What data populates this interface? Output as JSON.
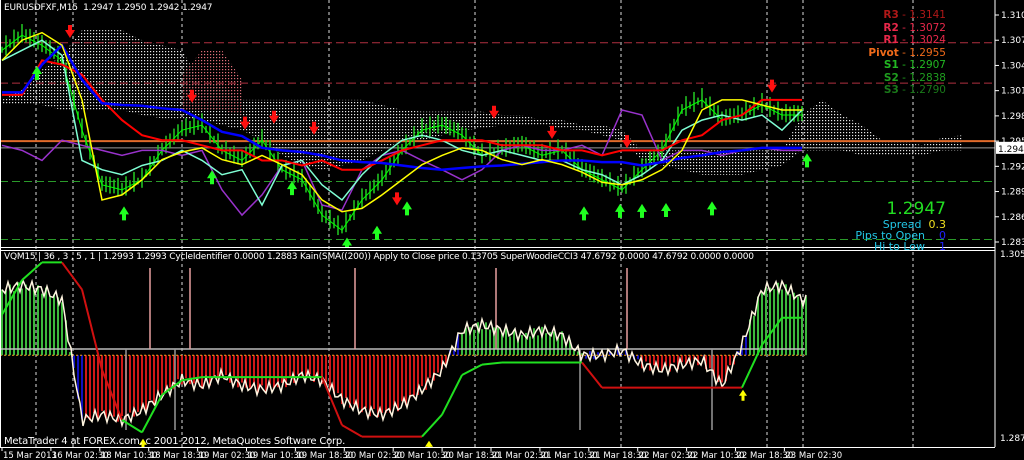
{
  "header": {
    "symbol": "EURUSDFXF,M15",
    "ohlc": "1.2947 1.2950 1.2942 1.2947"
  },
  "indicator_header": "VQM15 | 36 , 3 , 5 , 1 | 1.2993 1.2993 CycleIdentifier 0.0000 1.2883 Kain(SMA((200)) Apply to Close price 0.13705 SuperWoodieCCI3 47.6792 0.0000 47.6792 0.0000 0.0000",
  "copyright": "MetaTrader 4 at FOREX.com, c 2001-2012, MetaQuotes Software Corp.",
  "pivots": [
    {
      "label": "R3",
      "value": "1.3141",
      "color": "#b01818"
    },
    {
      "label": "R2",
      "value": "1.3072",
      "color": "#e8284a"
    },
    {
      "label": "R1",
      "value": "1.3024",
      "color": "#e8284a"
    },
    {
      "label": "Pivot",
      "value": "1.2955",
      "color": "#f06a1a"
    },
    {
      "label": "S1",
      "value": "1.2907",
      "color": "#22b822"
    },
    {
      "label": "S2",
      "value": "1.2838",
      "color": "#1f9e1f"
    },
    {
      "label": "S3",
      "value": "1.2790",
      "color": "#1a7a1a"
    }
  ],
  "info": {
    "price": "1.2947",
    "spread_label": "Spread",
    "spread_value": "0.3",
    "pips_label": "Pips to Open",
    "pips_value": "0",
    "hilo_label": "Hi to Low",
    "hilo_value": "1"
  },
  "colors": {
    "up": "#00ff00",
    "down": "#ff0000",
    "cyan": "#7fffd4",
    "purple": "#9932cc",
    "yellow": "#ffff00",
    "blue": "#0000ff"
  },
  "chart_data": [
    {
      "type": "line",
      "title": "EURUSDFXF,M15",
      "ylim": [
        1.2822,
        1.312
      ],
      "price_ticks": [
        "1.3105",
        "1.3075",
        "1.3045",
        "1.3015",
        "1.2985",
        "1.2955",
        "1.2925",
        "1.2895",
        "1.2865",
        "1.2835"
      ],
      "current_price": "1.2947",
      "time_labels": [
        "15 Mar 2013",
        "16 Mar 02:30",
        "18 Mar 10:30",
        "18 Mar 18:30",
        "19 Mar 02:30",
        "19 Mar 10:30",
        "19 Mar 18:30",
        "20 Mar 02:30",
        "20 Mar 10:30",
        "20 Mar 18:30",
        "21 Mar 02:30",
        "21 Mar 10:30",
        "21 Mar 18:30",
        "22 Mar 02:30",
        "22 Mar 10:30",
        "22 Mar 18:30",
        "23 Mar 02:30"
      ],
      "pivot_lines": [
        1.3072,
        1.3024,
        1.2955,
        1.2907,
        1.2838
      ],
      "series": [
        {
          "name": "close",
          "color": "#00ff00",
          "values": [
            1.3063,
            1.3081,
            1.3069,
            1.3051,
            1.2968,
            1.2903,
            1.2897,
            1.2909,
            1.2944,
            1.2968,
            1.2974,
            1.2944,
            1.2932,
            1.2956,
            1.2921,
            1.2909,
            1.2867,
            1.2849,
            1.2885,
            1.2909,
            1.2944,
            1.2968,
            1.2974,
            1.2962,
            1.2938,
            1.2944,
            1.295,
            1.2938,
            1.2944,
            1.2921,
            1.2909,
            1.2897,
            1.2921,
            1.2944,
            1.2992,
            1.3004,
            1.298,
            1.2986,
            1.2998,
            1.2986,
            1.2986
          ]
        },
        {
          "name": "purple",
          "color": "#9932cc",
          "values": [
            1.295,
            1.2944,
            1.2932,
            1.2956,
            1.295,
            1.2944,
            1.2938,
            1.2944,
            1.2944,
            1.2938,
            1.2944,
            1.2897,
            1.2867,
            1.2891,
            1.2926,
            1.2932,
            1.2879,
            1.2873,
            1.2921,
            1.2938,
            1.2944,
            1.2932,
            1.2921,
            1.2909,
            1.2921,
            1.2944,
            1.295,
            1.2944,
            1.2944,
            1.295,
            1.2938,
            1.2992,
            1.2986,
            1.2932,
            1.2944,
            1.2944,
            1.2938,
            1.2944,
            1.2947,
            1.2944,
            1.2944
          ]
        },
        {
          "name": "cyan",
          "color": "#7fffd4",
          "values": [
            1.3051,
            1.3063,
            1.3075,
            1.3057,
            1.2932,
            1.2921,
            1.2915,
            1.2926,
            1.2932,
            1.2944,
            1.2932,
            1.2915,
            1.2921,
            1.2879,
            1.2926,
            1.2932,
            1.2903,
            1.2885,
            1.2915,
            1.2938,
            1.2956,
            1.2962,
            1.2956,
            1.2944,
            1.2938,
            1.2944,
            1.2938,
            1.2932,
            1.2932,
            1.2921,
            1.2915,
            1.2903,
            1.2915,
            1.2932,
            1.2968,
            1.298,
            1.2986,
            1.298,
            1.2986,
            1.2968,
            1.2992
          ]
        },
        {
          "name": "red-step",
          "color": "#ff0000",
          "values": [
            1.301,
            1.301,
            1.3051,
            1.3046,
            1.3034,
            1.3004,
            1.298,
            1.2962,
            1.2956,
            1.2956,
            1.295,
            1.2944,
            1.2944,
            1.2932,
            1.2932,
            1.2926,
            1.2932,
            1.2921,
            1.2921,
            1.2932,
            1.2944,
            1.295,
            1.2956,
            1.2956,
            1.2956,
            1.295,
            1.295,
            1.295,
            1.2944,
            1.2944,
            1.2938,
            1.2944,
            1.2944,
            1.2944,
            1.2956,
            1.2962,
            1.298,
            1.2986,
            1.3004,
            1.3004,
            1.3004
          ]
        },
        {
          "name": "blue",
          "color": "#0000ff",
          "values": [
            1.3013,
            1.3013,
            1.3046,
            1.3069,
            1.3028,
            1.3,
            1.2998,
            1.2997,
            1.2994,
            1.2992,
            1.298,
            1.2966,
            1.2961,
            1.2947,
            1.2944,
            1.2942,
            1.2938,
            1.2932,
            1.293,
            1.2929,
            1.2926,
            1.2923,
            1.2921,
            1.2923,
            1.2925,
            1.2926,
            1.2928,
            1.293,
            1.2932,
            1.2932,
            1.293,
            1.293,
            1.2926,
            1.293,
            1.2935,
            1.2938,
            1.2942,
            1.2944,
            1.2947,
            1.2947,
            1.2947
          ]
        },
        {
          "name": "yellow",
          "color": "#ffff00",
          "values": [
            1.3051,
            1.3075,
            1.3084,
            1.3069,
            1.3004,
            1.2885,
            1.2891,
            1.2909,
            1.2933,
            1.2942,
            1.2947,
            1.2933,
            1.2927,
            1.2938,
            1.2927,
            1.2915,
            1.2885,
            1.2871,
            1.2875,
            1.2891,
            1.2909,
            1.2927,
            1.2938,
            1.2947,
            1.2944,
            1.2933,
            1.2927,
            1.2933,
            1.2927,
            1.2918,
            1.2906,
            1.2903,
            1.2909,
            1.2921,
            1.2944,
            1.2992,
            1.3004,
            1.3004,
            1.2998,
            1.2992,
            1.2992
          ]
        }
      ],
      "cloud": {
        "upper": [
          1.3004,
          1.3016,
          1.304,
          1.3057,
          1.3087,
          1.3087,
          1.3087,
          1.3075,
          1.3069,
          1.3063,
          1.3022,
          1.3022,
          1.3004,
          1.3004,
          1.3004,
          1.3004,
          1.3004,
          1.3004,
          1.3004,
          1.2998,
          1.2992,
          1.299,
          1.299,
          1.299,
          1.299,
          1.2986,
          1.2986,
          1.298,
          1.298,
          1.2974,
          1.2974,
          1.2968,
          1.2944,
          1.2944,
          1.2944,
          1.2944,
          1.2944,
          1.2944,
          1.2944,
          1.2944,
          1.2986,
          1.3004,
          1.2986,
          1.2974,
          1.2956,
          1.2956,
          1.295,
          1.2959,
          1.2962
        ],
        "lower": [
          1.2998,
          1.2998,
          1.2998,
          1.2992,
          1.2992,
          1.2992,
          1.2992,
          1.2986,
          1.2982,
          1.2982,
          1.298,
          1.2974,
          1.2968,
          1.2956,
          1.2938,
          1.2926,
          1.2921,
          1.2926,
          1.2932,
          1.2944,
          1.2956,
          1.2956,
          1.2962,
          1.2968,
          1.297,
          1.2974,
          1.2974,
          1.2974,
          1.297,
          1.2968,
          1.2962,
          1.2956,
          1.2932,
          1.2926,
          1.2921,
          1.2915,
          1.2915,
          1.2915,
          1.2921,
          1.2926,
          1.2944,
          1.2944,
          1.2944,
          1.2938,
          1.2938,
          1.2938,
          1.2938,
          1.2944,
          1.2944
        ]
      },
      "red_cloud": {
        "start": 9,
        "upper": [
          1.3034,
          1.3063,
          1.3063,
          1.3028
        ],
        "lower": [
          1.2992,
          1.2992,
          1.2992,
          1.2986
        ]
      },
      "sell_signals": [
        [
          3.4,
          1.308
        ],
        [
          9.5,
          1.3003
        ],
        [
          12.15,
          1.2971
        ],
        [
          13.6,
          1.2978
        ],
        [
          15.6,
          1.2965
        ],
        [
          19.75,
          1.2881
        ],
        [
          24.6,
          1.2984
        ],
        [
          27.5,
          1.296
        ],
        [
          31.25,
          1.2949
        ],
        [
          38.5,
          1.3015
        ]
      ],
      "buy_signals": [
        [
          1.75,
          1.3042
        ],
        [
          6.1,
          1.2875
        ],
        [
          10.5,
          1.2918
        ],
        [
          14.5,
          1.2905
        ],
        [
          17.25,
          1.2838
        ],
        [
          18.75,
          1.2852
        ],
        [
          20.25,
          1.2881
        ],
        [
          29.1,
          1.2875
        ],
        [
          30.9,
          1.2878
        ],
        [
          32,
          1.2878
        ],
        [
          33.2,
          1.2879
        ],
        [
          35.5,
          1.2881
        ],
        [
          40.25,
          1.2938
        ]
      ]
    },
    {
      "type": "line",
      "title": "VQM15 / SuperWoodieCCI3",
      "ylim": [
        1.2872,
        1.3057
      ],
      "ticks": [
        "1.3057",
        "1.2872"
      ],
      "zero_level": 1.2958,
      "step_level": 1.2964,
      "oscillator": [
        1.3021,
        1.3025,
        1.3021,
        1.3011,
        1.2896,
        1.2901,
        1.2896,
        1.2905,
        1.292,
        1.2934,
        1.2929,
        1.2939,
        1.2929,
        1.2925,
        1.2929,
        1.2939,
        1.2934,
        1.2915,
        1.2905,
        1.2901,
        1.291,
        1.2925,
        1.2944,
        1.2982,
        1.2987,
        1.2982,
        1.2977,
        1.2982,
        1.2977,
        1.2958,
        1.2958,
        1.2963,
        1.2949,
        1.2944,
        1.2949,
        1.2953,
        1.2929,
        1.2968,
        1.3021,
        1.3025,
        1.3011
      ],
      "trend": [
        1.2997,
        1.303,
        1.3047,
        1.3047,
        1.3021,
        1.2944,
        1.2896,
        1.2884,
        1.292,
        1.2934,
        1.2937,
        1.2937,
        1.2937,
        1.2937,
        1.2937,
        1.2937,
        1.2937,
        1.2891,
        1.288,
        1.288,
        1.288,
        1.288,
        1.2901,
        1.2939,
        1.2949,
        1.2951,
        1.2951,
        1.2951,
        1.2951,
        1.2951,
        1.2927,
        1.2927,
        1.2927,
        1.2927,
        1.2927,
        1.2927,
        1.2927,
        1.2927,
        1.2968,
        1.2994,
        1.2994
      ],
      "trend_dir": [
        "up",
        "up",
        "up",
        "up",
        "down",
        "down",
        "down",
        "up",
        "up",
        "up",
        "up",
        "up",
        "up",
        "up",
        "up",
        "up",
        "up",
        "down",
        "down",
        "down",
        "down",
        "down",
        "up",
        "up",
        "up",
        "up",
        "up",
        "up",
        "up",
        "up",
        "down",
        "down",
        "down",
        "down",
        "down",
        "down",
        "down",
        "down",
        "up",
        "up",
        "up"
      ],
      "cycle_peaks": [
        7.4,
        9.4,
        17.65,
        24.7,
        31.25
      ],
      "cycle_troughs": [
        6.2,
        8.65,
        28.9,
        35.5
      ],
      "buy_arrows": [
        [
          7.05,
          1.2877
        ],
        [
          21.35,
          1.2875
        ],
        [
          37.05,
          1.2924
        ]
      ]
    }
  ]
}
